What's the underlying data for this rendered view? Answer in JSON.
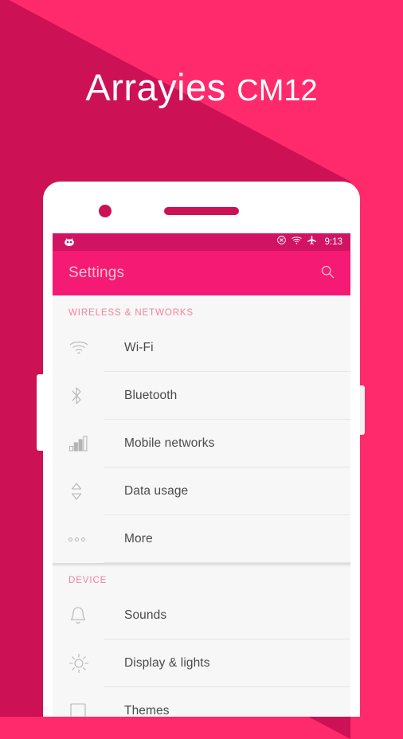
{
  "hero": {
    "title_main": "Arrayies",
    "title_suffix": "CM12"
  },
  "colors": {
    "background": "#ff2a6b",
    "shadow": "#cc1155",
    "statusbar": "#d11363",
    "toolbar": "#f51a73",
    "section_header": "#f5819f",
    "list_background": "#f7f7f7",
    "row_label": "#4a4a4a"
  },
  "phone": {
    "camera": "front-camera",
    "speaker": "earpiece-speaker",
    "volume_button": "volume-rocker",
    "power_button": "power-button"
  },
  "statusbar": {
    "logo": "cyanogenmod-cid-icon",
    "icons": [
      "silent-mode-icon",
      "wifi-icon",
      "airplane-mode-icon"
    ],
    "time": "9:13"
  },
  "toolbar": {
    "title": "Settings",
    "search_icon": "search-icon"
  },
  "sections": [
    {
      "header": "WIRELESS & NETWORKS",
      "rows": [
        {
          "label": "Wi-Fi",
          "icon": "wifi-icon"
        },
        {
          "label": "Bluetooth",
          "icon": "bluetooth-icon"
        },
        {
          "label": "Mobile networks",
          "icon": "signal-bars-icon"
        },
        {
          "label": "Data usage",
          "icon": "data-usage-icon"
        },
        {
          "label": "More",
          "icon": "more-icon"
        }
      ]
    },
    {
      "header": "DEVICE",
      "rows": [
        {
          "label": "Sounds",
          "icon": "bell-icon"
        },
        {
          "label": "Display & lights",
          "icon": "brightness-icon"
        },
        {
          "label": "Themes",
          "icon": "themes-icon"
        }
      ]
    }
  ]
}
